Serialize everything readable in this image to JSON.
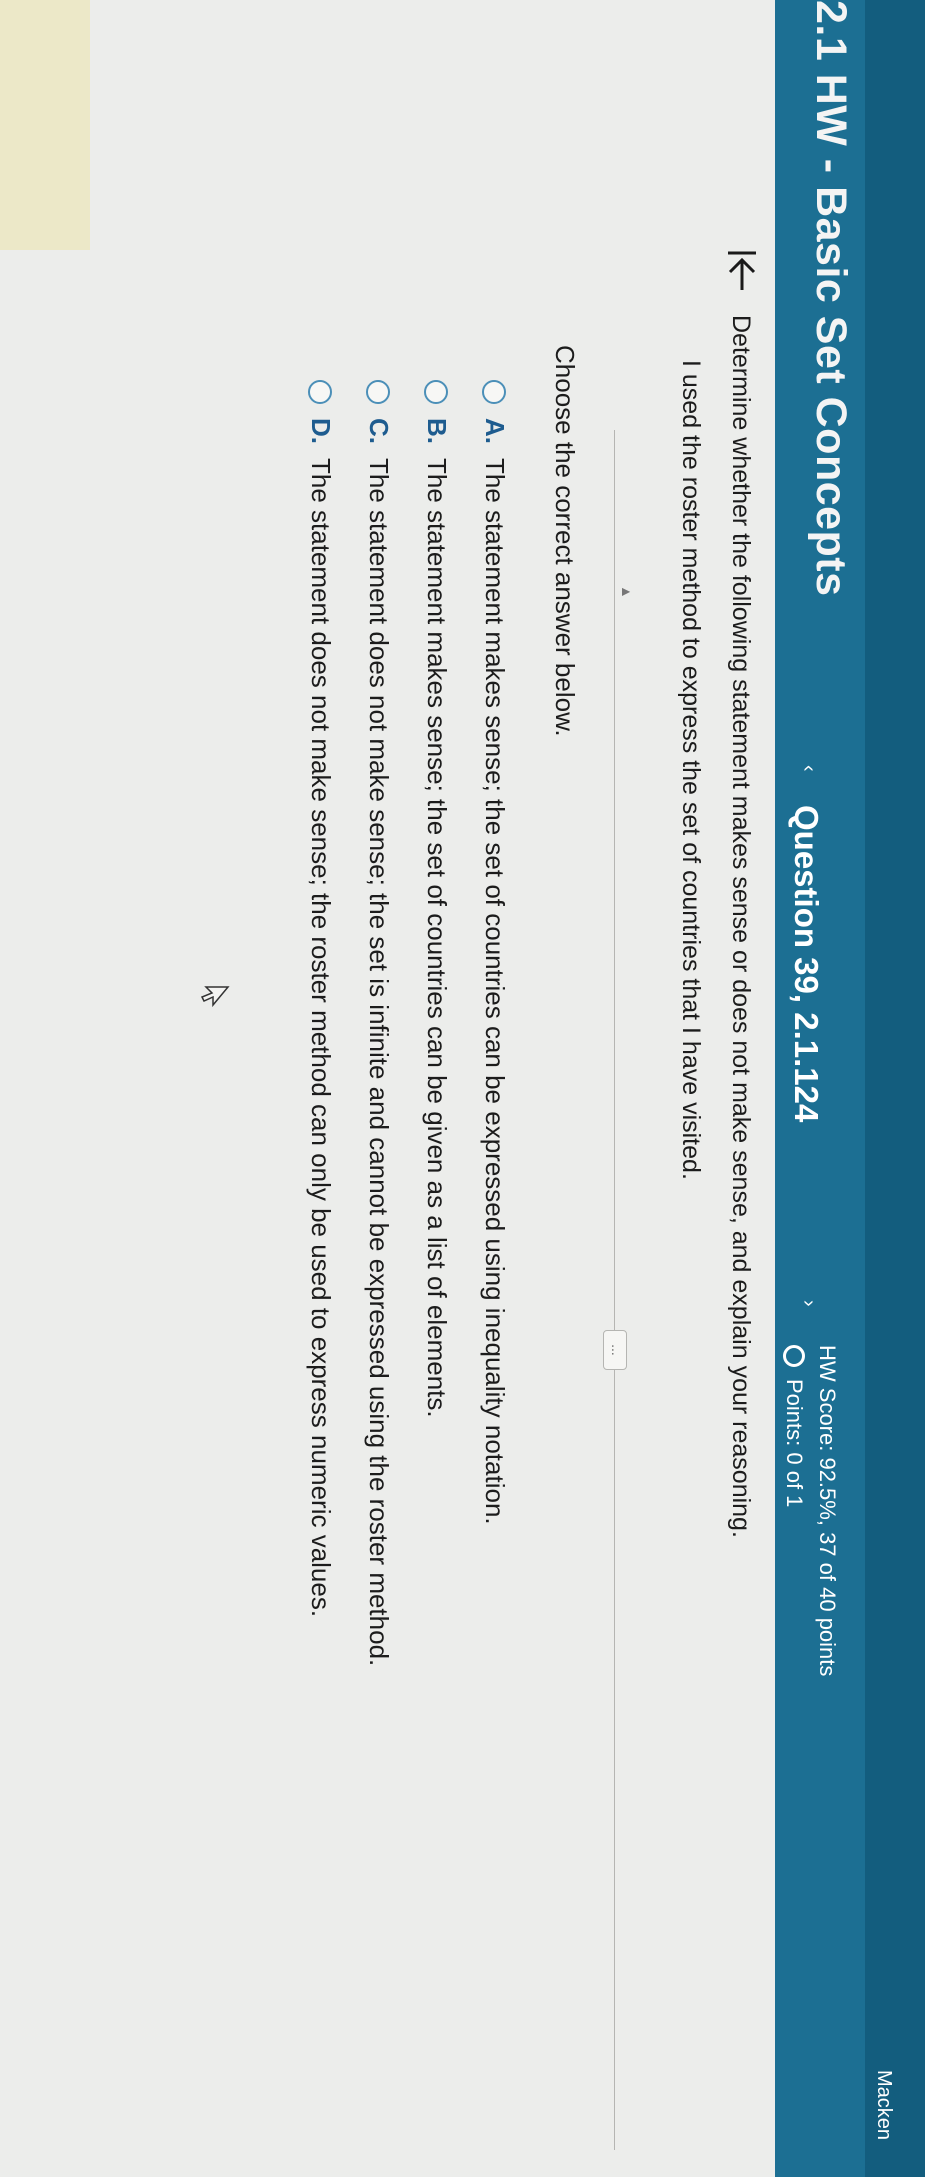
{
  "header": {
    "title": "2.1 HW - Basic Set Concepts",
    "question_label": "Question 39, 2.1.124",
    "nav_prev": "‹",
    "nav_next": "›",
    "hw_score": "HW Score: 92.5%, 37 of 40 points",
    "points": "Points: 0 of 1",
    "user_name": "Macken"
  },
  "question": {
    "instructions": "Determine whether the following statement makes sense or does not make sense, and explain your reasoning.",
    "statement": "I used the roster method to express the set of countries that I have visited.",
    "more_label": "...",
    "prompt": "Choose the correct answer below."
  },
  "options": [
    {
      "letter": "A.",
      "text": "The statement makes sense; the set of countries can be expressed using inequality notation."
    },
    {
      "letter": "B.",
      "text": "The statement makes sense; the set of countries can be given as a list of elements."
    },
    {
      "letter": "C.",
      "text": "The statement does not make sense; the set is infinite and cannot be expressed using the roster method."
    },
    {
      "letter": "D.",
      "text": "The statement does not make sense; the roster method can only be used to express numeric values."
    }
  ],
  "icons": {
    "collapse": "collapse-left-icon",
    "cursor": "mouse-pointer-icon"
  },
  "colors": {
    "header": "#1c6f93",
    "accent": "#1e5c8f"
  }
}
